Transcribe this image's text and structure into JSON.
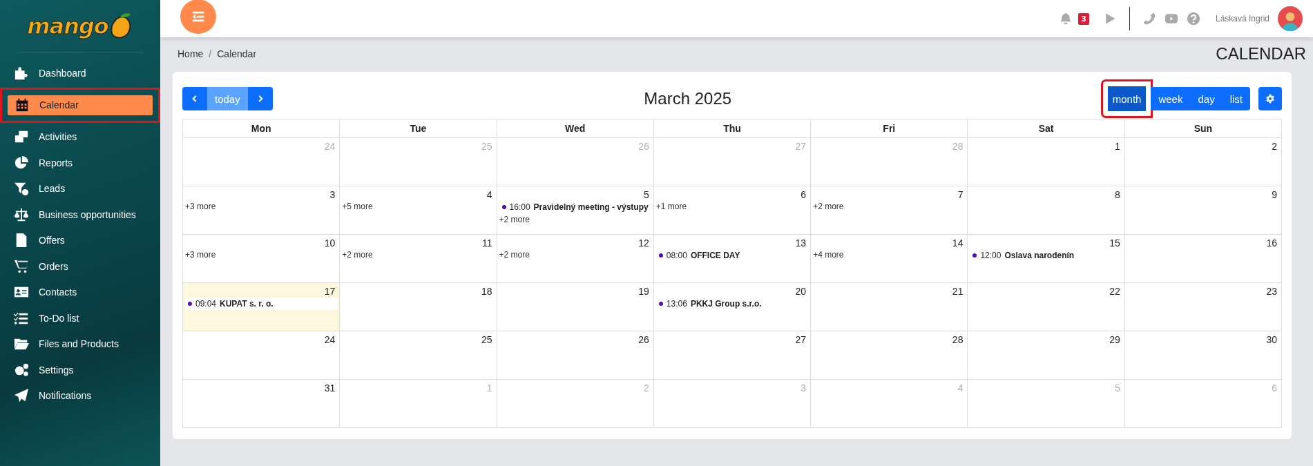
{
  "sidebar": {
    "logo": "mango",
    "items": [
      {
        "label": "Dashboard",
        "selected": false,
        "highlighted": false
      },
      {
        "label": "Calendar",
        "selected": true,
        "highlighted": true
      },
      {
        "label": "Activities",
        "selected": false,
        "highlighted": false
      },
      {
        "label": "Reports",
        "selected": false,
        "highlighted": false
      },
      {
        "label": "Leads",
        "selected": false,
        "highlighted": false
      },
      {
        "label": "Business opportunities",
        "selected": false,
        "highlighted": false
      },
      {
        "label": "Offers",
        "selected": false,
        "highlighted": false
      },
      {
        "label": "Orders",
        "selected": false,
        "highlighted": false
      },
      {
        "label": "Contacts",
        "selected": false,
        "highlighted": false
      },
      {
        "label": "To-Do list",
        "selected": false,
        "highlighted": false
      },
      {
        "label": "Files and Products",
        "selected": false,
        "highlighted": false
      },
      {
        "label": "Settings",
        "selected": false,
        "highlighted": false
      },
      {
        "label": "Notifications",
        "selected": false,
        "highlighted": false
      }
    ]
  },
  "topbar": {
    "notification_count": "3",
    "user_name": "Láskavá Ingrid"
  },
  "breadcrumb": {
    "separator": "/",
    "items": [
      "Home",
      "Calendar"
    ]
  },
  "page_title": "CALENDAR",
  "toolbar": {
    "today": "today",
    "title": "March 2025",
    "views": [
      {
        "label": "month",
        "selected": true,
        "highlighted": true
      },
      {
        "label": "week",
        "selected": false,
        "highlighted": false
      },
      {
        "label": "day",
        "selected": false,
        "highlighted": false
      },
      {
        "label": "list",
        "selected": false,
        "highlighted": false
      }
    ]
  },
  "weekdays": [
    "Mon",
    "Tue",
    "Wed",
    "Thu",
    "Fri",
    "Sat",
    "Sun"
  ],
  "weeks": [
    [
      {
        "day": "24",
        "other_month": true,
        "today": false
      },
      {
        "day": "25",
        "other_month": true,
        "today": false
      },
      {
        "day": "26",
        "other_month": true,
        "today": false
      },
      {
        "day": "27",
        "other_month": true,
        "today": false
      },
      {
        "day": "28",
        "other_month": true,
        "today": false
      },
      {
        "day": "1",
        "other_month": false,
        "today": false
      },
      {
        "day": "2",
        "other_month": false,
        "today": false
      }
    ],
    [
      {
        "day": "3",
        "other_month": false,
        "today": false,
        "more": "+3 more"
      },
      {
        "day": "4",
        "other_month": false,
        "today": false,
        "more": "+5 more"
      },
      {
        "day": "5",
        "other_month": false,
        "today": false,
        "events": [
          {
            "time": "16:00",
            "title": "Pravidelný meeting - výstupy"
          }
        ],
        "more": "+2 more"
      },
      {
        "day": "6",
        "other_month": false,
        "today": false,
        "more": "+1 more"
      },
      {
        "day": "7",
        "other_month": false,
        "today": false,
        "more": "+2 more"
      },
      {
        "day": "8",
        "other_month": false,
        "today": false
      },
      {
        "day": "9",
        "other_month": false,
        "today": false
      }
    ],
    [
      {
        "day": "10",
        "other_month": false,
        "today": false,
        "more": "+3 more"
      },
      {
        "day": "11",
        "other_month": false,
        "today": false,
        "more": "+2 more"
      },
      {
        "day": "12",
        "other_month": false,
        "today": false,
        "more": "+2 more"
      },
      {
        "day": "13",
        "other_month": false,
        "today": false,
        "events": [
          {
            "time": "08:00",
            "title": "OFFICE DAY"
          }
        ]
      },
      {
        "day": "14",
        "other_month": false,
        "today": false,
        "more": "+4 more"
      },
      {
        "day": "15",
        "other_month": false,
        "today": false,
        "events": [
          {
            "time": "12:00",
            "title": "Oslava narodenín"
          }
        ]
      },
      {
        "day": "16",
        "other_month": false,
        "today": false
      }
    ],
    [
      {
        "day": "17",
        "other_month": false,
        "today": true,
        "events": [
          {
            "time": "09:04",
            "title": "KUPAT s. r. o."
          }
        ]
      },
      {
        "day": "18",
        "other_month": false,
        "today": false
      },
      {
        "day": "19",
        "other_month": false,
        "today": false
      },
      {
        "day": "20",
        "other_month": false,
        "today": false,
        "events": [
          {
            "time": "13:06",
            "title": "PKKJ Group s.r.o."
          }
        ]
      },
      {
        "day": "21",
        "other_month": false,
        "today": false
      },
      {
        "day": "22",
        "other_month": false,
        "today": false
      },
      {
        "day": "23",
        "other_month": false,
        "today": false
      }
    ],
    [
      {
        "day": "24",
        "other_month": false,
        "today": false
      },
      {
        "day": "25",
        "other_month": false,
        "today": false
      },
      {
        "day": "26",
        "other_month": false,
        "today": false
      },
      {
        "day": "27",
        "other_month": false,
        "today": false
      },
      {
        "day": "28",
        "other_month": false,
        "today": false
      },
      {
        "day": "29",
        "other_month": false,
        "today": false
      },
      {
        "day": "30",
        "other_month": false,
        "today": false
      }
    ],
    [
      {
        "day": "31",
        "other_month": false,
        "today": false
      },
      {
        "day": "1",
        "other_month": true,
        "today": false
      },
      {
        "day": "2",
        "other_month": true,
        "today": false
      },
      {
        "day": "3",
        "other_month": true,
        "today": false
      },
      {
        "day": "4",
        "other_month": true,
        "today": false
      },
      {
        "day": "5",
        "other_month": true,
        "today": false
      },
      {
        "day": "6",
        "other_month": true,
        "today": false
      }
    ]
  ]
}
